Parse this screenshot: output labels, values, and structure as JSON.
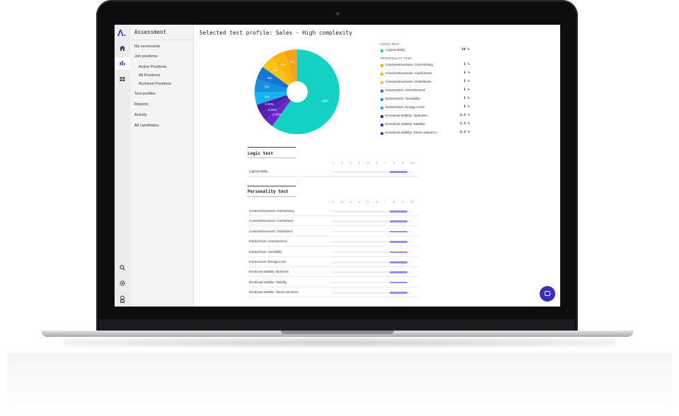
{
  "app": {
    "logo": "Λ.",
    "name": "Assessment"
  },
  "rail_icons": [
    "home-icon",
    "bar-chart-icon",
    "grid-icon",
    "search-icon",
    "gear-icon",
    "user-badge-icon"
  ],
  "sidebar": {
    "items": [
      {
        "label": "My scorecards"
      },
      {
        "label": "Job positions"
      },
      {
        "label": "Active Positions"
      },
      {
        "label": "All Positions"
      },
      {
        "label": "Archived Positions"
      },
      {
        "label": "Test profiles"
      },
      {
        "label": "Reports"
      },
      {
        "label": "Activity"
      },
      {
        "label": "All candidates"
      }
    ]
  },
  "main": {
    "title": "Selected test profile: Sales - High complexity"
  },
  "legend": {
    "logic_header": "LOGIC TEST",
    "personality_header": "PERSONALITY TEST",
    "items": [
      {
        "label": "Logical ability",
        "value": "60 %",
        "color": "#14d2c3"
      },
      {
        "label": "Conscientiousness: Goal-striving",
        "value": "5 %",
        "color": "#f7a21b"
      },
      {
        "label": "Conscientiousness: Carefulness",
        "value": "5 %",
        "color": "#f9b313"
      },
      {
        "label": "Conscientiousness: Orderliness",
        "value": "5 %",
        "color": "#fbc316"
      },
      {
        "label": "Extraversion: Assertiveness",
        "value": "5 %",
        "color": "#1574d4"
      },
      {
        "label": "Extraversion: Sociability",
        "value": "5 %",
        "color": "#1790e0"
      },
      {
        "label": "Extraversion: Energy Level",
        "value": "5 %",
        "color": "#17b3ef"
      },
      {
        "label": "Emotional stability: Optimism",
        "value": "3.3 %",
        "color": "#4b1fa6"
      },
      {
        "label": "Emotional stability: Stability",
        "value": "3.3 %",
        "color": "#5a23b8"
      },
      {
        "label": "Emotional stability: Stress tolerance",
        "value": "3.3 %",
        "color": "#6a28c6"
      }
    ]
  },
  "chart_data": {
    "type": "pie",
    "slices": [
      {
        "label": "Logical ability",
        "value": 60,
        "text": "60%",
        "color": "#14d2c3"
      },
      {
        "label": "Emotional stability: Stress tolerance",
        "value": 3.33,
        "text": "3.33%",
        "color": "#6a28c6"
      },
      {
        "label": "Emotional stability: Stability",
        "value": 3.33,
        "text": "3.33%",
        "color": "#5a23b8"
      },
      {
        "label": "Emotional stability: Optimism",
        "value": 3.33,
        "text": "3.33%",
        "color": "#4b1fa6"
      },
      {
        "label": "Extraversion: Energy Level",
        "value": 5,
        "text": "5%",
        "color": "#17b3ef"
      },
      {
        "label": "Extraversion: Sociability",
        "value": 5,
        "text": "5%",
        "color": "#1790e0"
      },
      {
        "label": "Extraversion: Assertiveness",
        "value": 5,
        "text": "5%",
        "color": "#1574d4"
      },
      {
        "label": "Conscientiousness: Orderliness",
        "value": 5,
        "text": "5%",
        "color": "#fbc316"
      },
      {
        "label": "Conscientiousness: Carefulness",
        "value": 5,
        "text": "5%",
        "color": "#f9b313"
      },
      {
        "label": "Conscientiousness: Goal-striving",
        "value": 5,
        "text": "5%",
        "color": "#f7a21b"
      }
    ]
  },
  "logic_section": {
    "title": "Logic test",
    "scale": [
      "1",
      "2",
      "3",
      "4",
      "5",
      "6",
      "7",
      "8",
      "9",
      "10"
    ],
    "rows": [
      {
        "label": "Logical ability",
        "range": [
          8,
          10
        ]
      }
    ]
  },
  "personality_section": {
    "title": "Personality test",
    "scale": [
      "1",
      "2",
      "3",
      "4",
      "5",
      "6",
      "7",
      "8",
      "9",
      "10"
    ],
    "rows": [
      {
        "label": "Conscientiousness: Goal-striving",
        "range": [
          8,
          10
        ]
      },
      {
        "label": "Conscientiousness: Carefulness",
        "range": [
          8,
          10
        ]
      },
      {
        "label": "Conscientiousness: Orderliness",
        "range": [
          8,
          10
        ]
      },
      {
        "label": "Extraversion: Assertiveness",
        "range": [
          8,
          10
        ]
      },
      {
        "label": "Extraversion: Sociability",
        "range": [
          8,
          10
        ]
      },
      {
        "label": "Extraversion: Energy Level",
        "range": [
          8,
          10
        ]
      },
      {
        "label": "Emotional stability: Optimism",
        "range": [
          8,
          10
        ]
      },
      {
        "label": "Emotional stability: Stability",
        "range": [
          8,
          10
        ]
      },
      {
        "label": "Emotional stability: Stress tolerance",
        "range": [
          8,
          10
        ]
      }
    ]
  },
  "colors": {
    "accent": "#3b2fd1",
    "bar": "#9b87f0",
    "chat_button": "#3a2db8"
  }
}
